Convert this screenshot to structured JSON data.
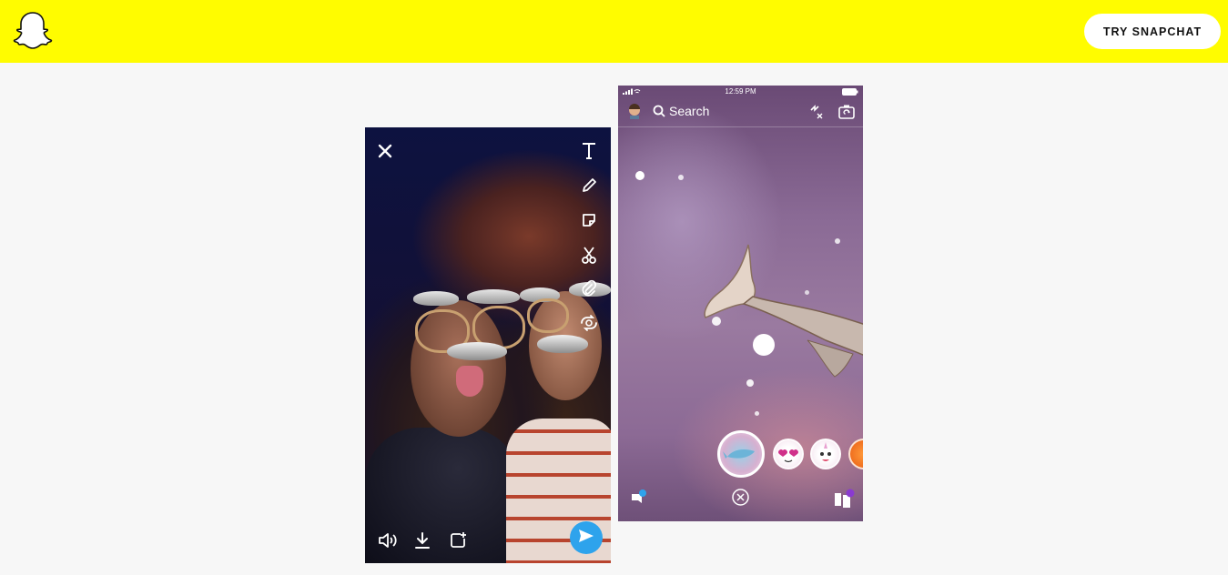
{
  "header": {
    "logo_icon": "snapchat-ghost-icon",
    "cta_label": "TRY SNAPCHAT",
    "bg_color": "#fffc00"
  },
  "left_phone": {
    "toolbar_icons": [
      "close-icon",
      "text-icon",
      "pencil-icon",
      "sticker-icon",
      "scissors-icon",
      "paperclip-icon",
      "loop-icon"
    ],
    "bottom_icons": [
      "volume-icon",
      "download-icon",
      "add-story-icon",
      "send-icon"
    ],
    "send_color": "#2ea3ec"
  },
  "right_phone": {
    "status_time": "12:59 PM",
    "search_placeholder": "Search",
    "top_icons": [
      "bitmoji-avatar-icon",
      "search-icon",
      "flash-off-icon",
      "flip-camera-icon"
    ],
    "lenses": [
      "whale-lens",
      "heart-eyes-lens",
      "unicorn-lens",
      "fox-lens"
    ],
    "bottom_icons": [
      "chat-icon",
      "capture-cancel-icon",
      "stories-icon"
    ]
  }
}
